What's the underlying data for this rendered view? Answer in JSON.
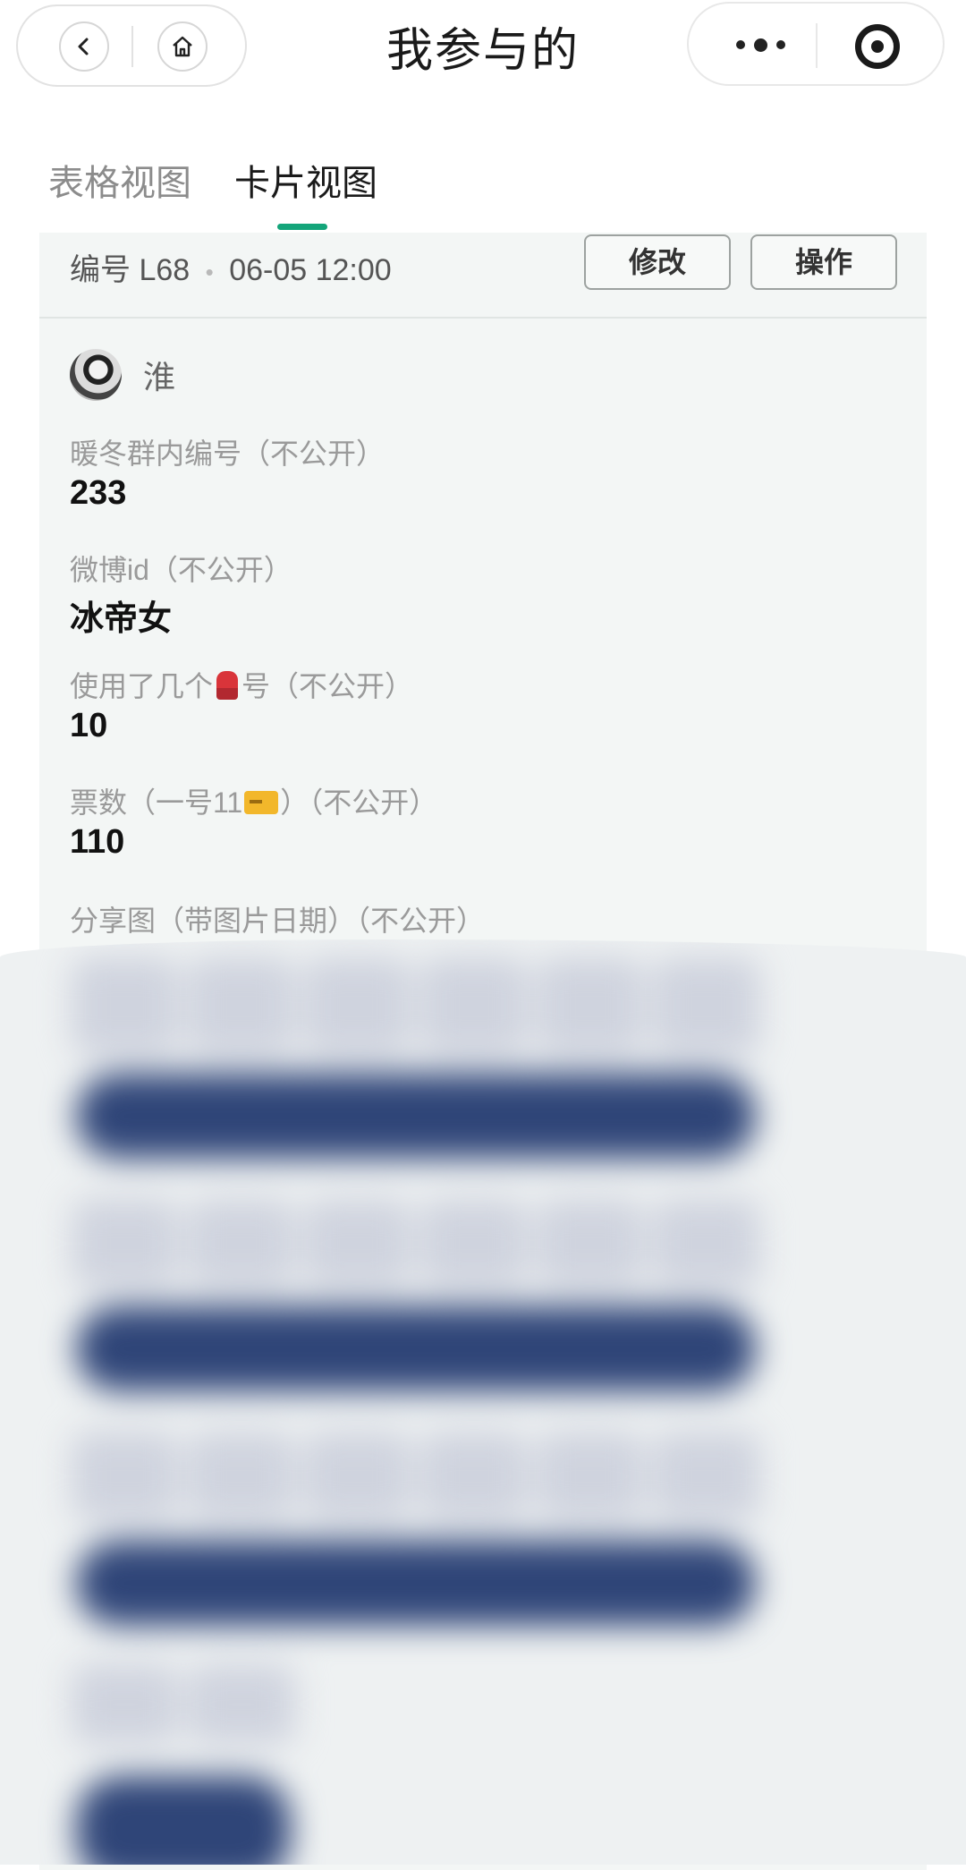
{
  "header": {
    "title": "我参与的"
  },
  "tabs": [
    {
      "label": "表格视图",
      "active": false
    },
    {
      "label": "卡片视图",
      "active": true
    }
  ],
  "card": {
    "number_prefix": "编号",
    "number": "L68",
    "timestamp": "06-05 12:00",
    "edit_label": "修改",
    "action_label": "操作",
    "user": {
      "name": "淮"
    },
    "fields": [
      {
        "label": "暖冬群内编号（不公开）",
        "value": "233"
      },
      {
        "label": "微博id（不公开）",
        "value": "冰帝女"
      },
      {
        "label_before": "使用了几个",
        "label_emoji": "scarf",
        "label_after": "号（不公开）",
        "value": "10"
      },
      {
        "label_before": "票数（一号11",
        "label_emoji": "ticket",
        "label_after": "）（不公开）",
        "value": "110"
      },
      {
        "label": "分享图（带图片日期）（不公开）"
      }
    ]
  },
  "colors": {
    "accent": "#14a57a",
    "card_bg": "#f3f6f5",
    "blur_band": "#2f4578"
  }
}
